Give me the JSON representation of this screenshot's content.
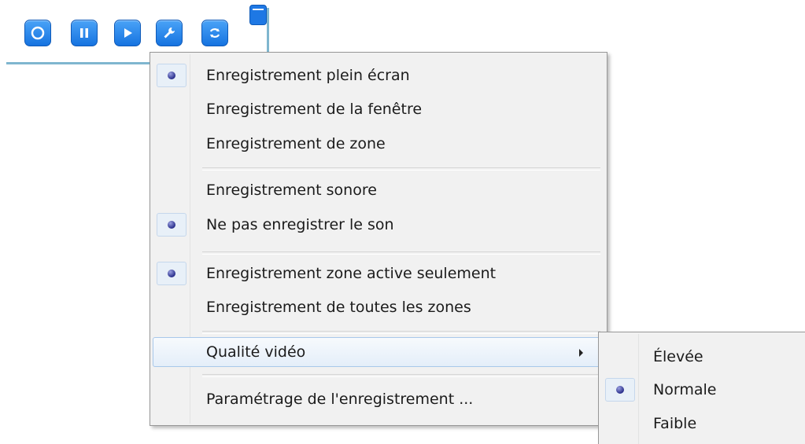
{
  "toolbar": {
    "buttons": [
      {
        "name": "record-icon"
      },
      {
        "name": "pause-icon"
      },
      {
        "name": "play-icon"
      },
      {
        "name": "wrench-icon"
      },
      {
        "name": "loop-icon"
      }
    ],
    "accent": "#1a74e0"
  },
  "menu": {
    "items": [
      {
        "label": "Enregistrement plein écran",
        "checked": true
      },
      {
        "label": "Enregistrement de la fenêtre",
        "checked": false
      },
      {
        "label": "Enregistrement de zone",
        "checked": false
      },
      {
        "label": "Enregistrement sonore",
        "checked": false
      },
      {
        "label": "Ne pas enregistrer le son",
        "checked": true
      },
      {
        "label": "Enregistrement zone active seulement",
        "checked": true
      },
      {
        "label": "Enregistrement de toutes les zones",
        "checked": false
      },
      {
        "label": "Qualité vidéo",
        "submenu": true,
        "highlighted": true
      },
      {
        "label": "Paramétrage de l'enregistrement ..."
      }
    ]
  },
  "submenu": {
    "items": [
      {
        "label": "Élevée",
        "checked": false
      },
      {
        "label": "Normale",
        "checked": true
      },
      {
        "label": "Faible",
        "checked": false
      }
    ]
  }
}
